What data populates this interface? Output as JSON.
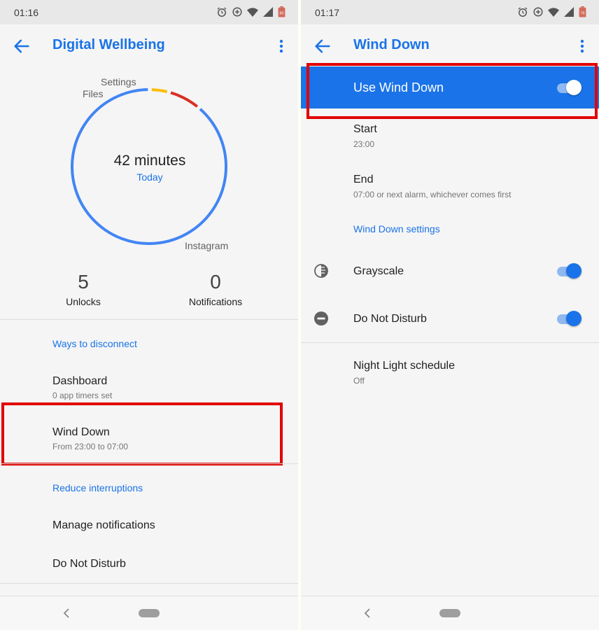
{
  "left": {
    "status": {
      "time": "01:16",
      "battery": "80"
    },
    "appbar": {
      "title": "Digital Wellbeing"
    },
    "usage": {
      "total": "42 minutes",
      "period": "Today",
      "apps": [
        {
          "name": "Settings",
          "fraction": 0.04,
          "color": "#fbbc04"
        },
        {
          "name": "Files",
          "fraction": 0.07,
          "color": "#d93025"
        },
        {
          "name": "Instagram",
          "fraction": 0.89,
          "color": "#4285f4"
        }
      ]
    },
    "stats": {
      "unlocks_value": "5",
      "unlocks_label": "Unlocks",
      "notifications_value": "0",
      "notifications_label": "Notifications"
    },
    "ways_header": "Ways to disconnect",
    "dashboard": {
      "title": "Dashboard",
      "subtitle": "0 app timers set"
    },
    "wind_down": {
      "title": "Wind Down",
      "subtitle": "From 23:00 to 07:00"
    },
    "reduce_header": "Reduce interruptions",
    "manage_notifications": "Manage notifications",
    "do_not_disturb": "Do Not Disturb"
  },
  "right": {
    "status": {
      "time": "01:17",
      "battery": "79"
    },
    "appbar": {
      "title": "Wind Down"
    },
    "use_wind_down": {
      "label": "Use Wind Down",
      "on": true
    },
    "start": {
      "title": "Start",
      "value": "23:00"
    },
    "end": {
      "title": "End",
      "value": "07:00 or next alarm, whichever comes first"
    },
    "settings_header": "Wind Down settings",
    "grayscale": {
      "label": "Grayscale",
      "on": true,
      "icon": "grayscale-icon"
    },
    "dnd": {
      "label": "Do Not Disturb",
      "on": true,
      "icon": "do-not-disturb-icon"
    },
    "night_light": {
      "title": "Night Light schedule",
      "value": "Off",
      "icon": "moon-icon"
    }
  },
  "colors": {
    "accent": "#1a73e8",
    "highlight": "#e10000",
    "toggle_track": "#90b8f0"
  }
}
